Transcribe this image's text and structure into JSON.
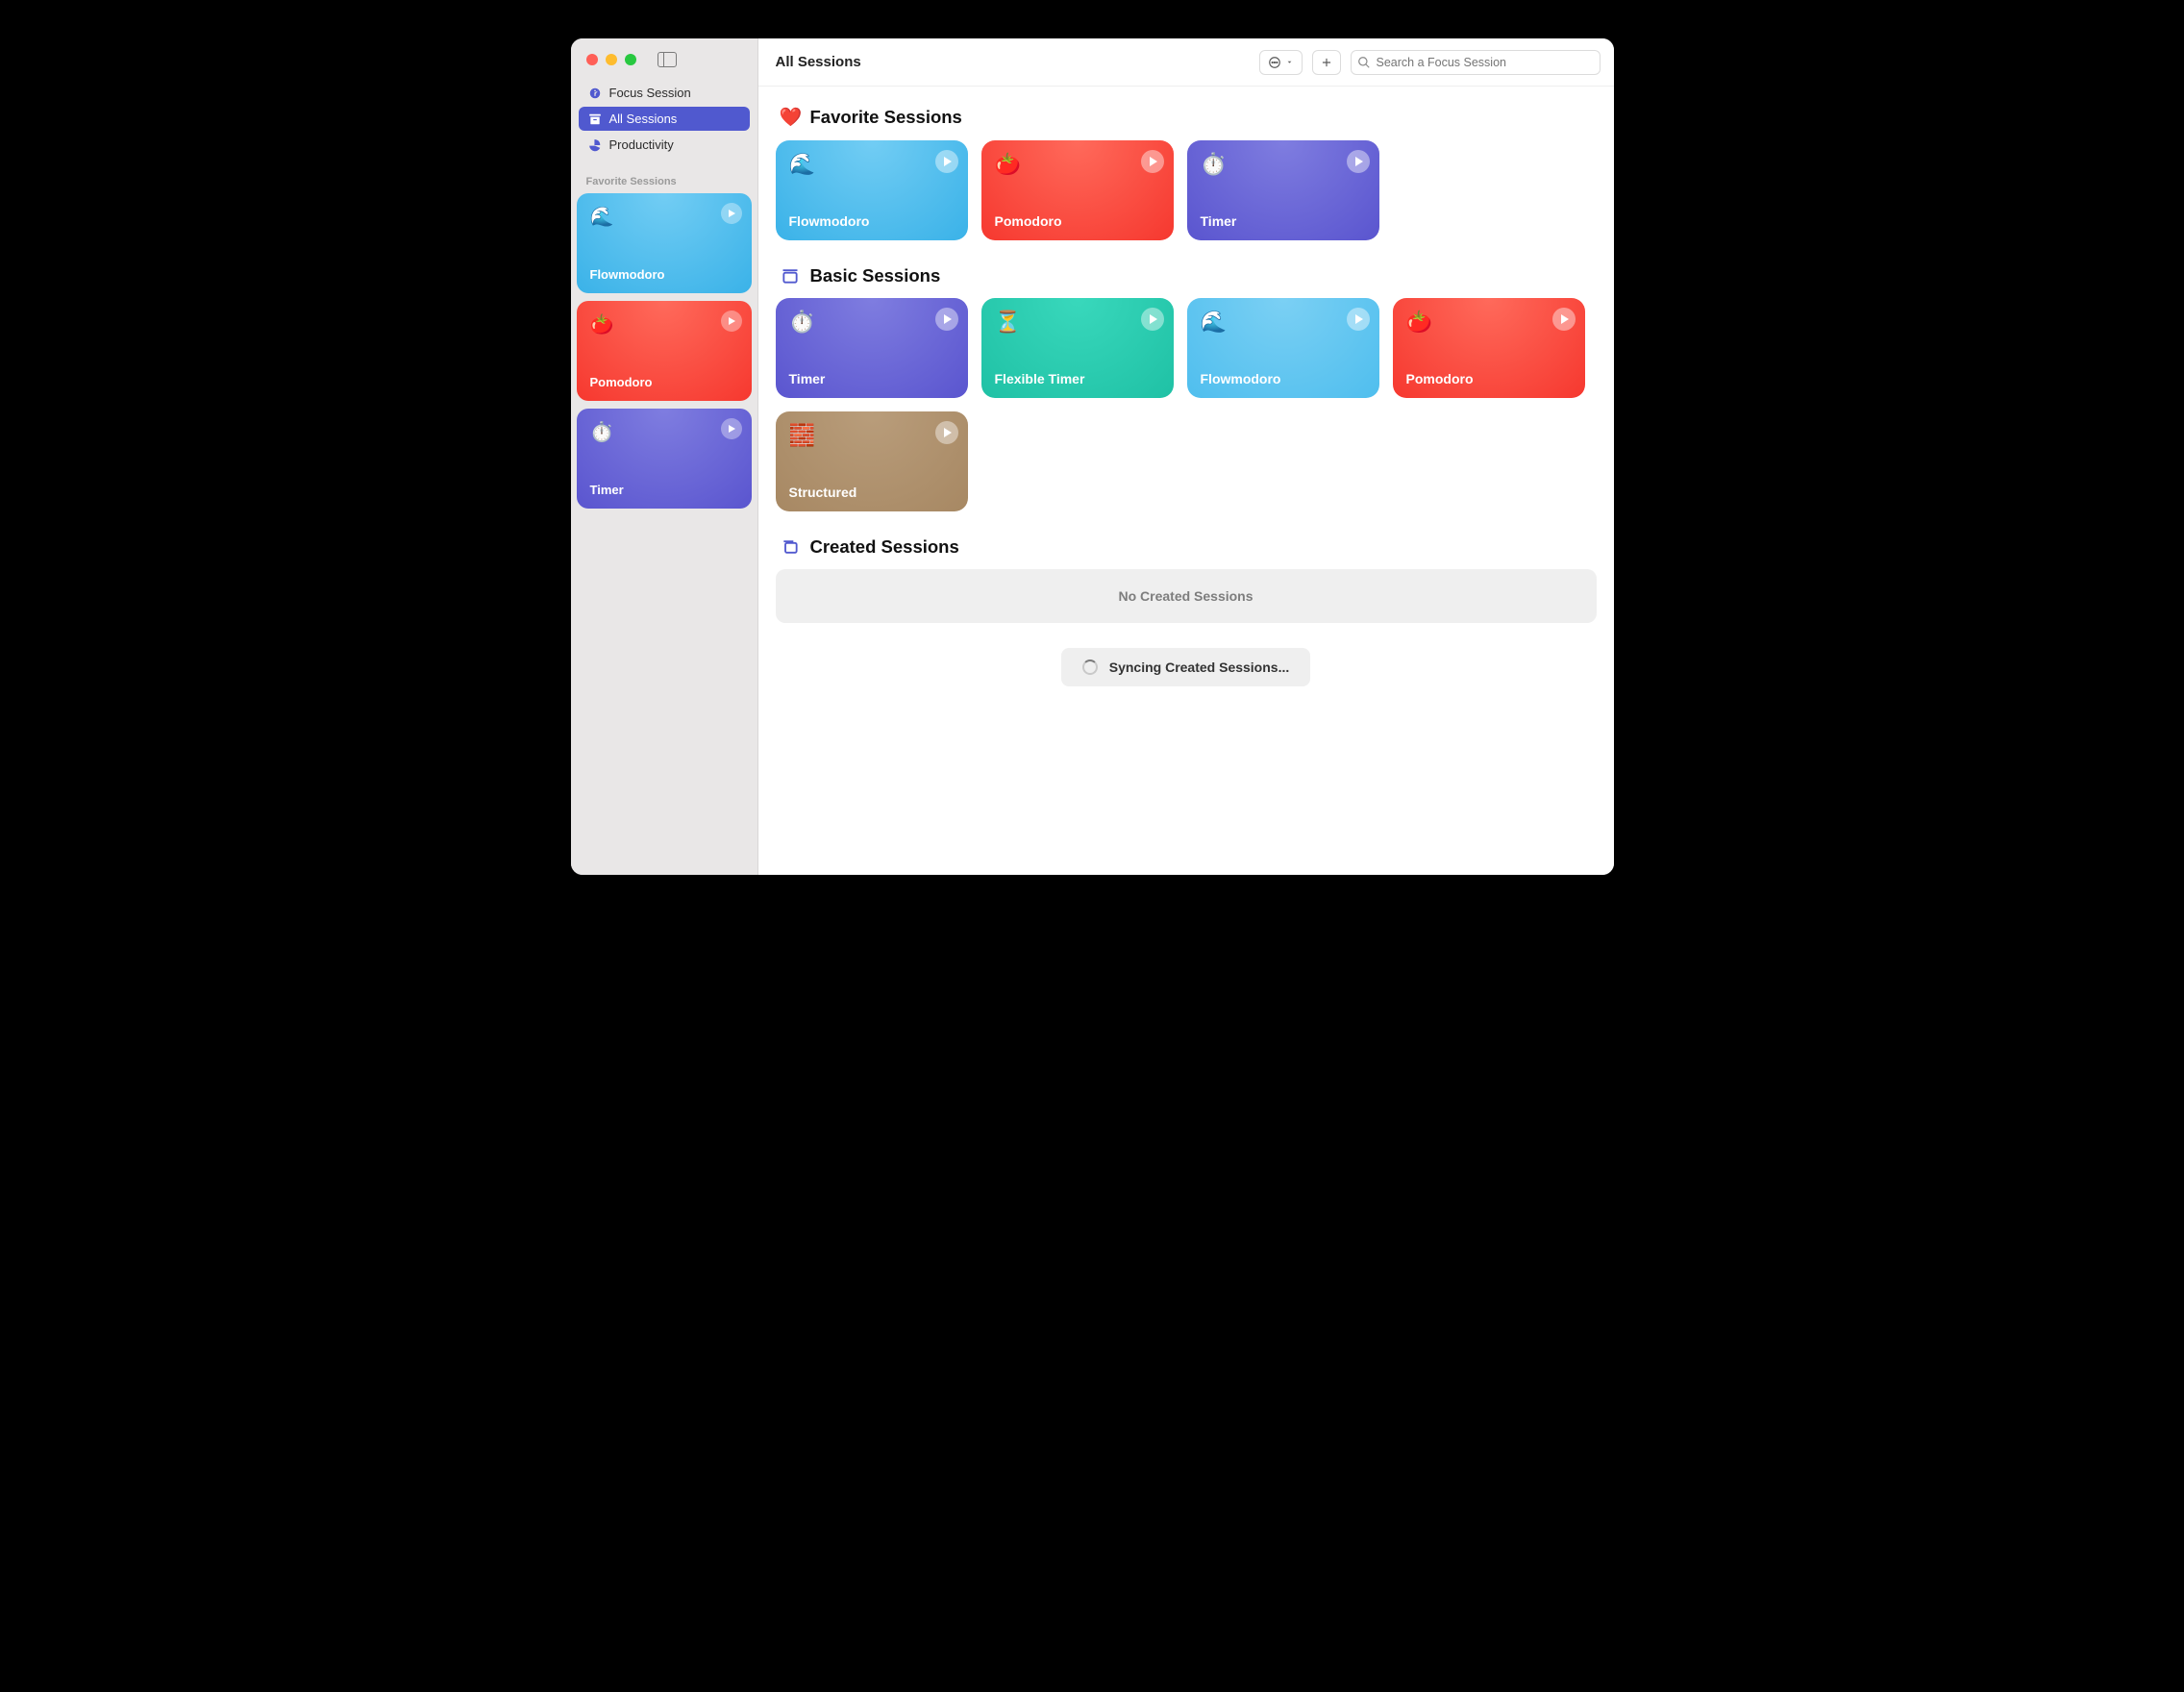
{
  "toolbar": {
    "title": "All Sessions",
    "search_placeholder": "Search a Focus Session"
  },
  "sidebar": {
    "nav": [
      {
        "label": "Focus Session",
        "icon": "gauge"
      },
      {
        "label": "All Sessions",
        "icon": "archive",
        "selected": true
      },
      {
        "label": "Productivity",
        "icon": "pie"
      }
    ],
    "favorites_header": "Favorite Sessions",
    "favorites": [
      {
        "name": "Flowmodoro",
        "emoji": "🌊",
        "gradient": "g-skyblue"
      },
      {
        "name": "Pomodoro",
        "emoji": "🍅",
        "gradient": "g-red"
      },
      {
        "name": "Timer",
        "emoji": "⏱️",
        "gradient": "g-indigo"
      }
    ]
  },
  "sections": {
    "favorite": {
      "title": "Favorite Sessions",
      "icon": "❤️",
      "cards": [
        {
          "name": "Flowmodoro",
          "emoji": "🌊",
          "gradient": "g-skyblue"
        },
        {
          "name": "Pomodoro",
          "emoji": "🍅",
          "gradient": "g-red"
        },
        {
          "name": "Timer",
          "emoji": "⏱️",
          "gradient": "g-indigo"
        }
      ]
    },
    "basic": {
      "title": "Basic Sessions",
      "icon": "archive-outline",
      "cards": [
        {
          "name": "Timer",
          "emoji": "⏱️",
          "gradient": "g-indigo"
        },
        {
          "name": "Flexible Timer",
          "emoji": "⏳",
          "gradient": "g-teal"
        },
        {
          "name": "Flowmodoro",
          "emoji": "🌊",
          "gradient": "g-skyblue2"
        },
        {
          "name": "Pomodoro",
          "emoji": "🍅",
          "gradient": "g-red"
        },
        {
          "name": "Structured",
          "emoji": "🧱",
          "gradient": "g-brown"
        }
      ]
    },
    "created": {
      "title": "Created Sessions",
      "icon": "stack-outline",
      "empty_text": "No Created Sessions"
    }
  },
  "syncing_text": "Syncing Created Sessions..."
}
